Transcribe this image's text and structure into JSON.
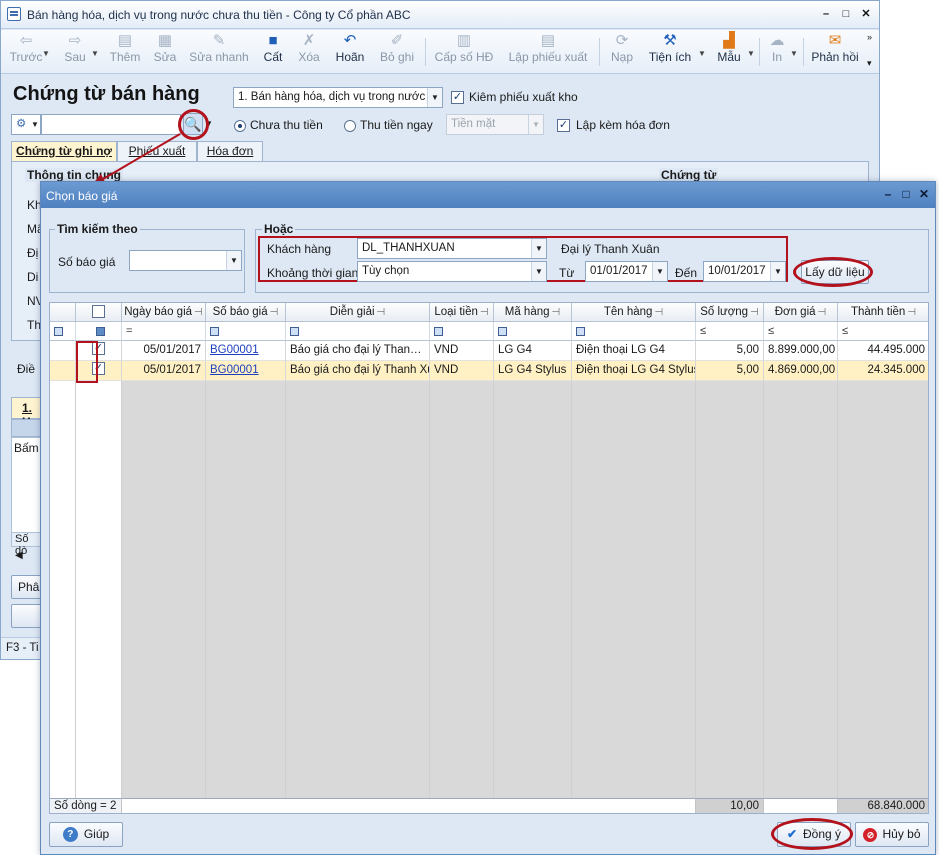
{
  "main_window": {
    "title": "Bán hàng hóa, dịch vụ trong nước chưa thu tiền - Công ty Cổ phần ABC",
    "toolbar": [
      {
        "name": "prev",
        "label": "Trước",
        "icon": "arrow-left-icon",
        "disabled": true
      },
      {
        "name": "next",
        "label": "Sau",
        "icon": "arrow-right-icon",
        "disabled": true
      },
      {
        "name": "add",
        "label": "Thêm",
        "icon": "add-document-icon",
        "disabled": true
      },
      {
        "name": "edit",
        "label": "Sửa",
        "icon": "edit-document-icon",
        "disabled": true
      },
      {
        "name": "quick-edit",
        "label": "Sửa nhanh",
        "icon": "quick-edit-icon",
        "disabled": true
      },
      {
        "name": "save",
        "label": "Cất",
        "icon": "floppy-disk-icon",
        "disabled": false
      },
      {
        "name": "delete",
        "label": "Xóa",
        "icon": "delete-document-icon",
        "disabled": true
      },
      {
        "name": "undo",
        "label": "Hoãn",
        "icon": "undo-icon",
        "disabled": false
      },
      {
        "name": "unpost",
        "label": "Bỏ ghi",
        "icon": "unpost-icon",
        "disabled": true
      },
      {
        "name": "invoice-number",
        "label": "Cấp số HĐ",
        "icon": "invoice-number-icon",
        "disabled": true
      },
      {
        "name": "create-delivery",
        "label": "Lập phiếu xuất",
        "icon": "delivery-note-icon",
        "disabled": true
      },
      {
        "name": "load",
        "label": "Nạp",
        "icon": "reload-icon",
        "disabled": true
      },
      {
        "name": "utilities",
        "label": "Tiện ích",
        "icon": "tools-icon",
        "disabled": false
      },
      {
        "name": "templates",
        "label": "Mẫu",
        "icon": "template-chart-icon",
        "disabled": false
      },
      {
        "name": "print",
        "label": "In",
        "icon": "printer-icon",
        "disabled": true
      },
      {
        "name": "feedback",
        "label": "Phản hồi",
        "icon": "envelope-icon",
        "disabled": false
      }
    ],
    "page_title": "Chứng từ bán hàng",
    "transaction_type": "1. Bán hàng hóa, dịch vụ trong nước",
    "check_delivery_note": "Kiêm phiếu xuất kho",
    "radio_unpaid": "Chưa thu tiền",
    "radio_paid": "Thu tiền ngay",
    "payment_method": "Tiền mặt",
    "check_invoice": "Lập kèm hóa đơn",
    "tabs": [
      "Chứng từ ghi nợ",
      "Phiếu xuất",
      "Hóa đơn"
    ],
    "section_general": "Thông tin chung",
    "section_voucher": "Chứng từ",
    "left_labels": [
      "Kh",
      "Mã",
      "Đị",
      "Di",
      "NV",
      "Th"
    ],
    "hidden_label_dieu": "Điề",
    "lower_tab": "1. H",
    "bam_text": "Bấm",
    "so_dong_short": "Số dò",
    "phan_btn": "Phân",
    "f3_text": "F3 - Ti"
  },
  "dialog": {
    "title": "Chọn báo giá",
    "search_group_title": "Tìm kiếm theo",
    "quote_no_label": "Số báo giá",
    "quote_no_value": "",
    "or_group_title": "Hoặc",
    "customer_label": "Khách hàng",
    "customer_value": "DL_THANHXUAN",
    "customer_name": "Đại lý Thanh Xuân",
    "period_label": "Khoảng thời gian",
    "period_value": "Tùy chọn",
    "from_label": "Từ",
    "from_value": "01/01/2017",
    "to_label": "Đến",
    "to_value": "10/01/2017",
    "fetch_button": "Lấy dữ liệu",
    "grid": {
      "columns": [
        "Ngày báo giá",
        "Số báo giá",
        "Diễn giải",
        "Loại tiền",
        "Mã hàng",
        "Tên hàng",
        "Số lượng",
        "Đơn giá",
        "Thành tiền"
      ],
      "filter_eq": "=",
      "filter_le": "≤",
      "rows": [
        {
          "checked": true,
          "date": "05/01/2017",
          "quote": "BG00001",
          "desc": "Báo giá cho đại lý Thanh Xuân",
          "currency": "VND",
          "item_code": "LG G4",
          "item_name": "Điện thoại LG G4",
          "qty": "5,00",
          "price": "8.899.000,00",
          "amount": "44.495.000"
        },
        {
          "checked": true,
          "date": "05/01/2017",
          "quote": "BG00001",
          "desc": "Báo giá cho đại lý Thanh Xuân",
          "currency": "VND",
          "item_code": "LG G4 Stylus",
          "item_name": "Điện thoại LG G4 Stylus",
          "qty": "5,00",
          "price": "4.869.000,00",
          "amount": "24.345.000"
        }
      ],
      "footer_count": "Số dòng = 2",
      "footer_qty": "10,00",
      "footer_amount": "68.840.000"
    },
    "help_button": "Giúp",
    "ok_button": "Đồng ý",
    "cancel_button": "Hủy bỏ"
  }
}
